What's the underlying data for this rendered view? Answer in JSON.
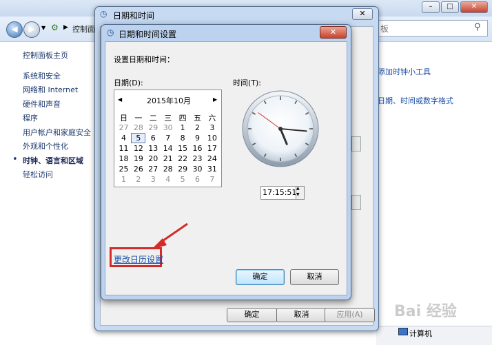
{
  "control_panel": {
    "address_text": "控制面",
    "search_placeholder": "搜索控制面板",
    "search_visible_text": "板",
    "sidebar": [
      "控制面板主页",
      "系统和安全",
      "网络和 Internet",
      "硬件和声音",
      "程序",
      "用户帐户和家庭安全",
      "外观和个性化",
      "时钟、语言和区域",
      "轻松访问"
    ],
    "current_index": 7,
    "right_links": [
      "添加时钟小工具",
      "日期、时间或数字格式"
    ],
    "status_computer": "计算机"
  },
  "outer_dialog": {
    "title": "日期和时间",
    "buttons": {
      "ok": "确定",
      "cancel": "取消",
      "apply": "应用(A)"
    }
  },
  "inner_dialog": {
    "title": "日期和时间设置",
    "heading": "设置日期和时间：",
    "date_label": "日期(D):",
    "time_label": "时间(T):",
    "calendar": {
      "month": "2015年10月",
      "weekdays": [
        "日",
        "一",
        "二",
        "三",
        "四",
        "五",
        "六"
      ],
      "weeks": [
        [
          "27",
          "28",
          "29",
          "30",
          "1",
          "2",
          "3"
        ],
        [
          "4",
          "5",
          "6",
          "7",
          "8",
          "9",
          "10"
        ],
        [
          "11",
          "12",
          "13",
          "14",
          "15",
          "16",
          "17"
        ],
        [
          "18",
          "19",
          "20",
          "21",
          "22",
          "23",
          "24"
        ],
        [
          "25",
          "26",
          "27",
          "28",
          "29",
          "30",
          "31"
        ],
        [
          "1",
          "2",
          "3",
          "4",
          "5",
          "6",
          "7"
        ]
      ],
      "selected_day": "5"
    },
    "time_value": "17:15:51",
    "change_calendar_link": "更改日历设置",
    "ok": "确定",
    "cancel": "取消"
  },
  "watermark": "Bai 经验",
  "colors": {
    "highlight": "#d42a2a",
    "link": "#1a4ea8"
  }
}
